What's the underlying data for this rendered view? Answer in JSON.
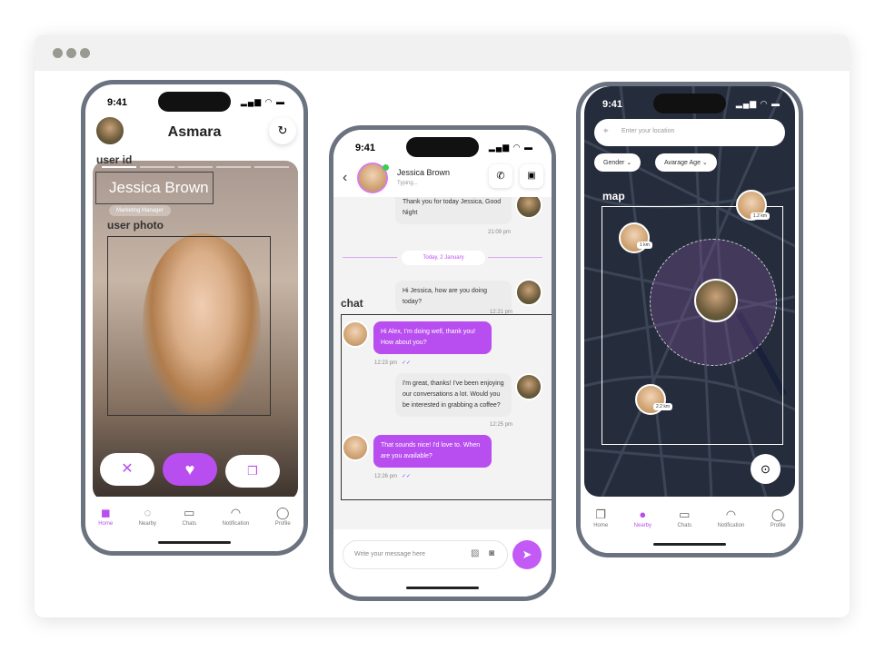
{
  "window": {
    "dots": [
      "#9a9a92",
      "#9a9a92",
      "#9a9a92"
    ]
  },
  "status": {
    "time": "9:41"
  },
  "swipe": {
    "app_title": "Asmara",
    "user_id_label": "user id",
    "name": "Jessica Brown",
    "job": "Marketing Manager",
    "user_photo_label": "user photo",
    "refresh_icon": "refresh-icon",
    "buttons": {
      "reject": "close-icon",
      "like": "heart-icon",
      "message": "chat-bubbles-icon"
    }
  },
  "nav": {
    "items": [
      "Home",
      "Nearby",
      "Chats",
      "Notification",
      "Profile"
    ]
  },
  "chat": {
    "contact_name": "Jessica Brown",
    "contact_status": "Typing...",
    "chat_label": "chat",
    "date_divider": "Today, 2 January",
    "input_placeholder": "Write your message here",
    "messages": [
      {
        "from": "me",
        "text": "Thank you for today Jessica, Good Night",
        "time": "21:09 pm"
      },
      {
        "from": "me",
        "text": "Hi Jessica, how are you doing today?",
        "time": "12:21 pm"
      },
      {
        "from": "her",
        "text": "Hi Alex, I'm doing well, thank you! How about you?",
        "time": "12:23 pm"
      },
      {
        "from": "me",
        "text": "I'm great, thanks! I've been enjoying our conversations a lot. Would you be interested in grabbing a coffee?",
        "time": "12:25 pm"
      },
      {
        "from": "her",
        "text": "That sounds nice! I'd love to. When are you available?",
        "time": "12:26 pm"
      }
    ]
  },
  "map": {
    "search_placeholder": "Enter your location",
    "filters": [
      "Gender",
      "Avarage Age"
    ],
    "map_label": "map",
    "distances": [
      "1.2 km",
      "1 km",
      "2.2 km"
    ]
  },
  "colors": {
    "accent": "#b94ef0",
    "map_bg": "#252d3d"
  }
}
